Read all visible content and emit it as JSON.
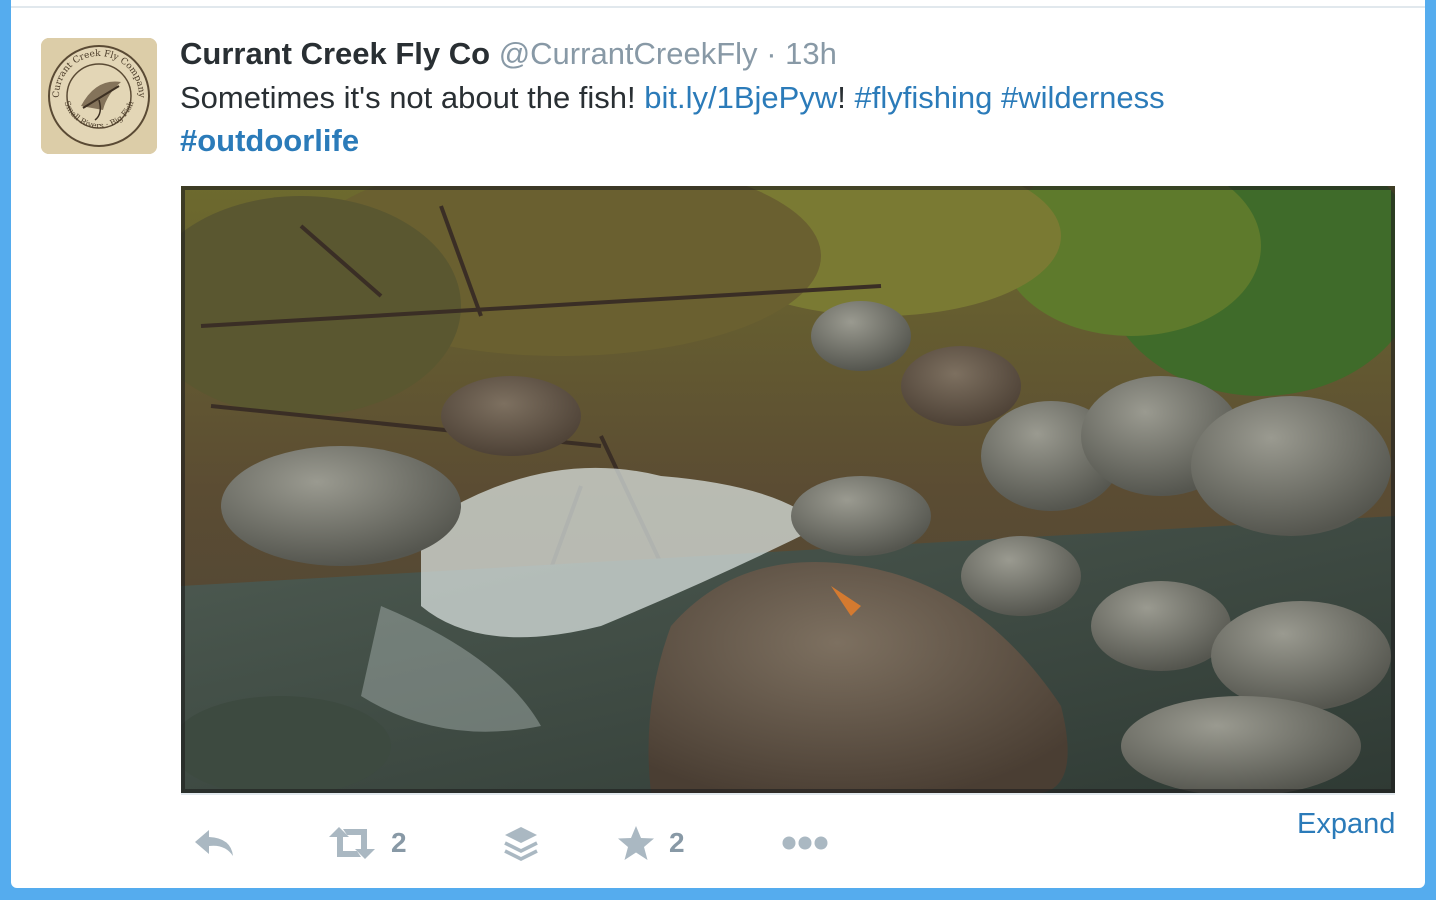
{
  "tweet": {
    "fullname": "Currant Creek Fly Co",
    "username": "@CurrantCreekFly",
    "separator": "·",
    "time": "13h",
    "text_prefix": "Sometimes it's not about the fish! ",
    "link": "bit.ly/1BjePyw",
    "text_after_link": "!",
    "hashtags": [
      "#flyfishing",
      "#wilderness",
      "#outdoorlife"
    ]
  },
  "avatar": {
    "text_top": "Currant Creek Fly Company",
    "text_bottom": "Small Rivers · Big Fish"
  },
  "actions": {
    "reply_icon": "reply-icon",
    "retweet_icon": "retweet-icon",
    "retweet_count": "2",
    "buffer_icon": "stack-icon",
    "favorite_icon": "star-icon",
    "favorite_count": "2",
    "more_icon": "more-icon",
    "expand_label": "Expand"
  },
  "colors": {
    "page_bg": "#55acee",
    "link": "#2b7bb9",
    "muted": "#8899a6"
  }
}
